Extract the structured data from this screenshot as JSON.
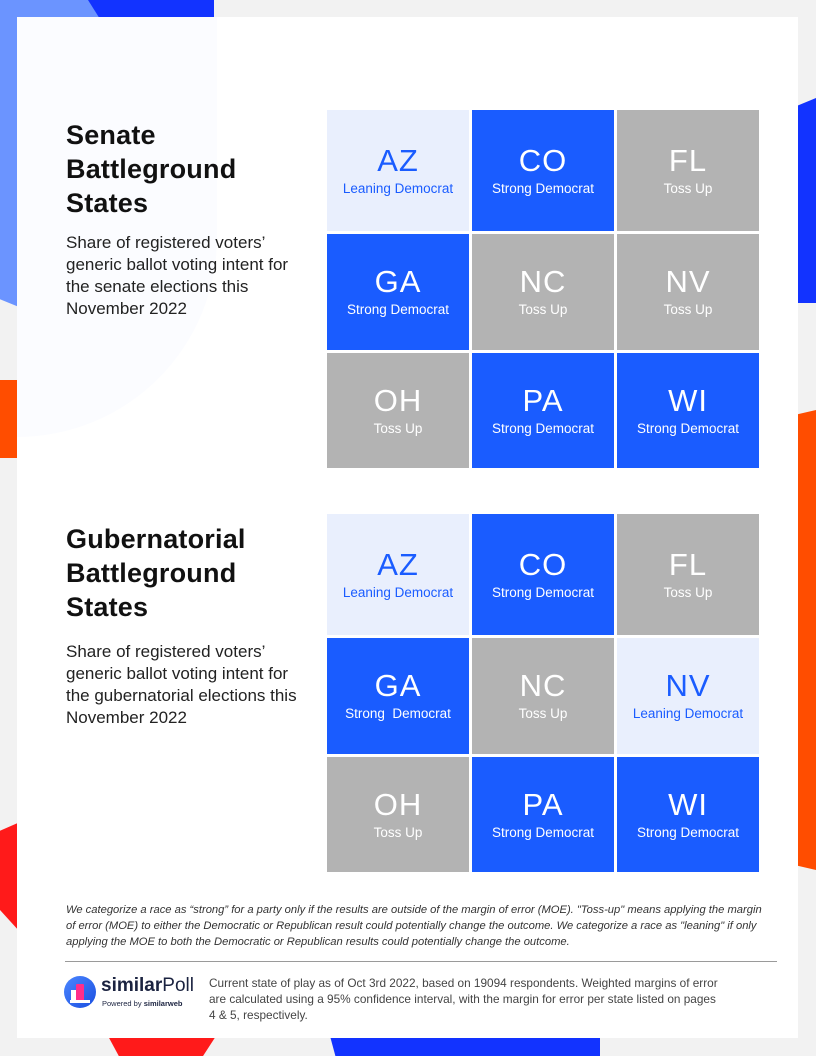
{
  "colors": {
    "strong_democrat": "#1a5cff",
    "leaning_democrat_bg": "#e9effd",
    "leaning_democrat_text": "#1a5cff",
    "toss_up": "#b3b3b3",
    "page_background": "#f2f2f2",
    "accent_blue": "#1233ff",
    "accent_light_blue": "#6b94ff",
    "accent_orange": "#ff4d00",
    "accent_red": "#ff1a1a"
  },
  "senate": {
    "title_lines": [
      "Senate",
      "Battleground",
      "States"
    ],
    "description_lines": [
      "Share of registered voters’",
      "generic ballot voting intent for",
      "the senate elections this",
      "November 2022"
    ],
    "states": [
      {
        "code": "AZ",
        "category": "Leaning Democrat",
        "type": "leaning"
      },
      {
        "code": "CO",
        "category": "Strong Democrat",
        "type": "strong"
      },
      {
        "code": "FL",
        "category": "Toss Up",
        "type": "toss"
      },
      {
        "code": "GA",
        "category": "Strong Democrat",
        "type": "strong"
      },
      {
        "code": "NC",
        "category": "Toss Up",
        "type": "toss"
      },
      {
        "code": "NV",
        "category": "Toss Up",
        "type": "toss"
      },
      {
        "code": "OH",
        "category": "Toss Up",
        "type": "toss"
      },
      {
        "code": "PA",
        "category": "Strong Democrat",
        "type": "strong"
      },
      {
        "code": "WI",
        "category": "Strong Democrat",
        "type": "strong"
      }
    ]
  },
  "gubernatorial": {
    "title_lines": [
      "Gubernatorial",
      "Battleground",
      "States"
    ],
    "description_lines": [
      "Share of registered voters’",
      "generic ballot voting intent for",
      "the gubernatorial elections this",
      "November 2022"
    ],
    "states": [
      {
        "code": "AZ",
        "category": "Leaning Democrat",
        "type": "leaning"
      },
      {
        "code": "CO",
        "category": "Strong Democrat",
        "type": "strong"
      },
      {
        "code": "FL",
        "category": "Toss Up",
        "type": "toss"
      },
      {
        "code": "GA",
        "category": "Strong  Democrat",
        "type": "strong"
      },
      {
        "code": "NC",
        "category": "Toss Up",
        "type": "toss"
      },
      {
        "code": "NV",
        "category": "Leaning Democrat",
        "type": "leaning"
      },
      {
        "code": "OH",
        "category": "Toss Up",
        "type": "toss"
      },
      {
        "code": "PA",
        "category": "Strong Democrat",
        "type": "strong"
      },
      {
        "code": "WI",
        "category": "Strong Democrat",
        "type": "strong"
      }
    ]
  },
  "methodology_note": "We categorize a race as “strong” for a party only if the results are outside of the margin of error (MOE). \"Toss-up\" means applying the margin of error (MOE) to either the Democratic or Republican result could potentially change the outcome. We categorize a race as \"leaning\" if only applying the MOE to both the Democratic or Republican results could potentially change the outcome.",
  "footer": {
    "logo": {
      "icon": "similarpoll-logo-icon",
      "name_bold": "similar",
      "name_regular": "Poll",
      "powered_by": "Powered by",
      "powered_by_brand": "similarweb"
    },
    "text": "Current state of play as of Oct 3rd 2022, based on 19094  respondents. Weighted margins of error are calculated using a 95% confidence interval, with the margin for error per state listed on pages 4 & 5, respectively."
  }
}
